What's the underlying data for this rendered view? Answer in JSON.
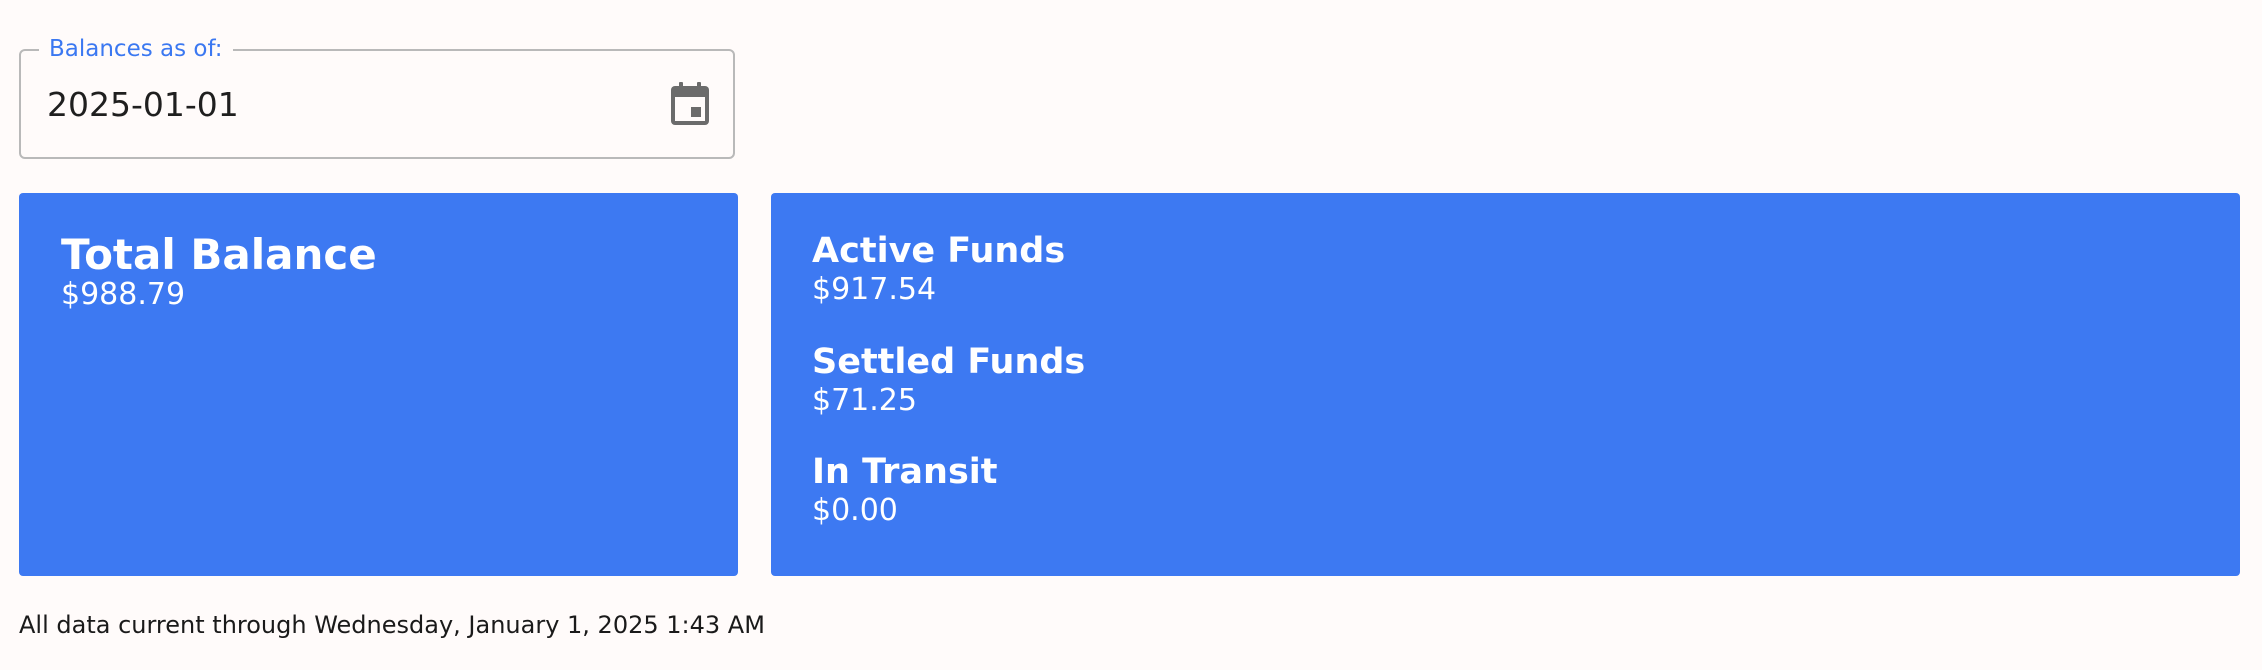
{
  "date_picker": {
    "legend": "Balances as of:",
    "value": "2025-01-01",
    "icon": "calendar-icon"
  },
  "total_card": {
    "title": "Total Balance",
    "value": "$988.79"
  },
  "funds_card": {
    "items": [
      {
        "label": "Active Funds",
        "value": "$917.54"
      },
      {
        "label": "Settled Funds",
        "value": "$71.25"
      },
      {
        "label": "In Transit",
        "value": "$0.00"
      }
    ]
  },
  "footer": {
    "note": "All data current through Wednesday, January 1, 2025 1:43 AM"
  },
  "colors": {
    "background": "#fffbfa",
    "card": "#3d79f2",
    "legend": "#3b78f1",
    "field_border": "#b9b9b9",
    "icon": "#6b6b6b"
  }
}
